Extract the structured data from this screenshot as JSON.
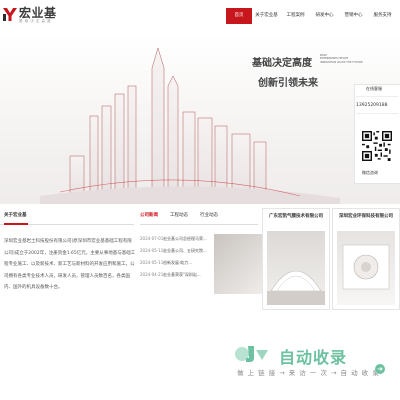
{
  "header": {
    "logo_text": "宏业基",
    "logo_sub": "基 础 决 定 高 度",
    "nav": [
      "首页",
      "关于宏业基",
      "工程案例",
      "研发中心",
      "营销中心",
      "服务支持"
    ],
    "nav_active_index": 0
  },
  "hero": {
    "headline_1": "基础决定高度",
    "headline_2": "创新引领未来",
    "en_lines": [
      "BASE",
      "ENTERPRISES HEIGHT",
      "INNOVATION LEADS THE FUTURE"
    ]
  },
  "side_panel": {
    "tag": "在线客服",
    "phone": "13925209188",
    "wechat_label": "微信咨询"
  },
  "about": {
    "title": "关于宏业基",
    "text": "深圳宏业基岩土科技股份有限公司(原深圳市宏业基基础工程有限公司)成立于2002年，注册资金1.65亿元，主要从事地基与基础工程专业施工、以及新技术、新工艺与新材料的开发应用和施工，公司拥有各类专业技术人员，研发人员，管理人员数百名，各类国内、国外的机具设备数十台。"
  },
  "news": {
    "tabs": [
      "公司新闻",
      "工程动态",
      "行业动态"
    ],
    "items": [
      {
        "date": "2024-07-01",
        "title": "宏业基公司总经理马荣..."
      },
      {
        "date": "2024-05-11",
        "title": "宏业基公司、五研究院..."
      },
      {
        "date": "2024-05-11",
        "title": "创新发展·助力..."
      },
      {
        "date": "2024-04-21",
        "title": "宏业基荣获\"深圳岩..."
      }
    ]
  },
  "companies": [
    {
      "name": "广东宏凯气膜技术有限公司"
    },
    {
      "name": "深圳宏业环保科技有限公司"
    }
  ],
  "watermark": {
    "brand": "自动收录",
    "slogan": "做 上 链 接 → 来 访 一 次 → 自 动 收 录"
  },
  "colors": {
    "brand_red": "#c8161d",
    "watermark_green": "#6cc1a0"
  }
}
